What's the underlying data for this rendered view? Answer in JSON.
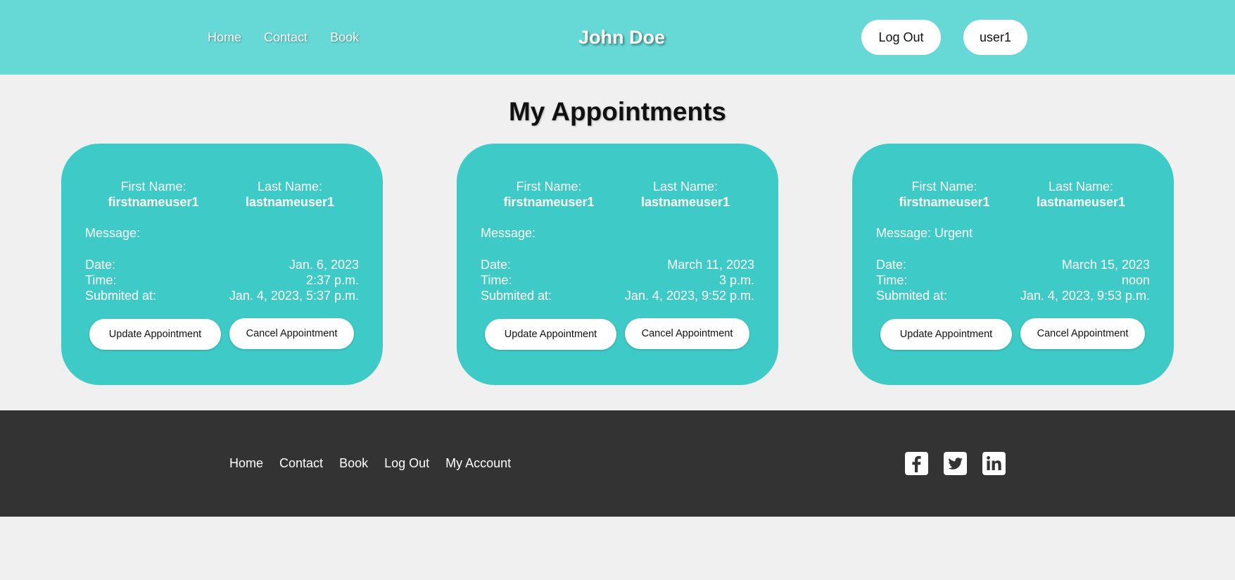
{
  "header": {
    "nav": [
      "Home",
      "Contact",
      "Book"
    ],
    "brand": "John Doe",
    "logout_label": "Log Out",
    "user_label": "user1"
  },
  "main": {
    "title": "My Appointments",
    "labels": {
      "first_name": "First Name:",
      "last_name": "Last Name:",
      "date": "Date:",
      "time": "Time:",
      "submitted": "Submited at:",
      "update": "Update Appointment",
      "cancel": "Cancel Appointment"
    },
    "appointments": [
      {
        "first_name": "firstnameuser1",
        "last_name": "lastnameuser1",
        "message": "Message:",
        "date": "Jan. 6, 2023",
        "time": "2:37 p.m.",
        "submitted": "Jan. 4, 2023, 5:37 p.m."
      },
      {
        "first_name": "firstnameuser1",
        "last_name": "lastnameuser1",
        "message": "Message:",
        "date": "March 11, 2023",
        "time": "3 p.m.",
        "submitted": "Jan. 4, 2023, 9:52 p.m."
      },
      {
        "first_name": "firstnameuser1",
        "last_name": "lastnameuser1",
        "message": "Message: Urgent",
        "date": "March 15, 2023",
        "time": "noon",
        "submitted": "Jan. 4, 2023, 9:53 p.m."
      }
    ]
  },
  "footer": {
    "nav": [
      "Home",
      "Contact",
      "Book",
      "Log Out",
      "My Account"
    ],
    "social": [
      "facebook-icon",
      "twitter-icon",
      "linkedin-icon"
    ]
  },
  "colors": {
    "header_bg": "#66d8d6",
    "card_bg": "#3ecbc7",
    "page_bg": "#f0f0f0",
    "footer_bg": "#333333"
  }
}
